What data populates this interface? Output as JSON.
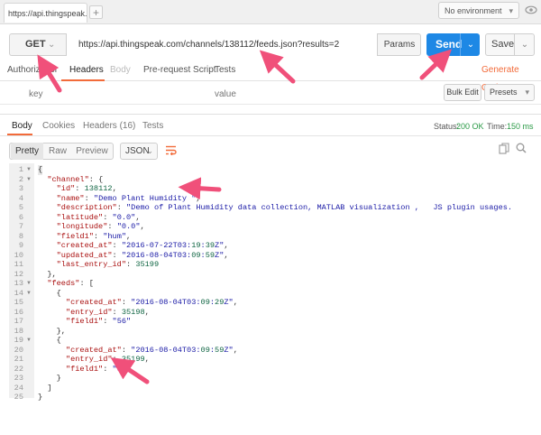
{
  "tabs": {
    "url_tab": "https://api.thingspeak.com/",
    "add_tab": "+"
  },
  "environment": {
    "selected": "No environment"
  },
  "request": {
    "method": "GET",
    "url": "https://api.thingspeak.com/channels/138112/feeds.json?results=2",
    "params_label": "Params",
    "send_label": "Send",
    "save_label": "Save"
  },
  "request_tabs": [
    "Authorization",
    "Headers",
    "Body",
    "Pre-request Script",
    "Tests"
  ],
  "generate_code_label": "Generate Code",
  "headers_editor": {
    "key_placeholder": "key",
    "value_placeholder": "value",
    "bulk_edit_label": "Bulk Edit",
    "presets_label": "Presets"
  },
  "response_tabs": [
    "Body",
    "Cookies",
    "Headers (16)",
    "Tests"
  ],
  "response_meta": {
    "status_label": "Status:",
    "status_value": "200 OK",
    "time_label": "Time:",
    "time_value": "150 ms"
  },
  "view_modes": [
    "Pretty",
    "Raw",
    "Preview"
  ],
  "format": "JSON",
  "code_lines": [
    "{",
    "  \"channel\": {",
    "    \"id\": 138112,",
    "    \"name\": \"Demo Plant Humidity \",",
    "    \"description\": \"Demo of Plant Humidity data collection, MATLAB visualization ,   JS plugin usages.      \",",
    "    \"latitude\": \"0.0\",",
    "    \"longitude\": \"0.0\",",
    "    \"field1\": \"hum\",",
    "    \"created_at\": \"2016-07-22T03:19:39Z\",",
    "    \"updated_at\": \"2016-08-04T03:09:59Z\",",
    "    \"last_entry_id\": 35199",
    "  },",
    "  \"feeds\": [",
    "    {",
    "      \"created_at\": \"2016-08-04T03:09:29Z\",",
    "      \"entry_id\": 35198,",
    "      \"field1\": \"56\"",
    "    },",
    "    {",
    "      \"created_at\": \"2016-08-04T03:09:59Z\",",
    "      \"entry_id\": 35199,",
    "      \"field1\": \"57\"",
    "    }",
    "  ]",
    "}"
  ],
  "colors": {
    "accent": "#f26b3a",
    "send": "#1e88e5",
    "annotation_arrow": "#f0507a",
    "status_ok": "#2b9a47"
  }
}
